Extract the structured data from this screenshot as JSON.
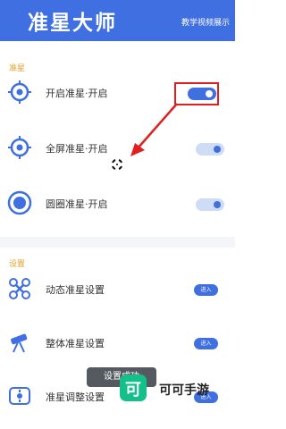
{
  "header": {
    "title": "准星大师",
    "tutorial_link": "教学视频展示"
  },
  "sections": {
    "crosshair": {
      "label": "准星",
      "items": [
        {
          "label": "开启准星·开启",
          "toggle_on": true
        },
        {
          "label": "全屏准星·开启",
          "toggle_on": false
        },
        {
          "label": "圆圈准星·开启",
          "toggle_on": false
        }
      ]
    },
    "settings": {
      "label": "设置",
      "items": [
        {
          "label": "动态准星设置",
          "button": "进入"
        },
        {
          "label": "整体准星设置",
          "button": "进入"
        },
        {
          "label": "准星调整设置",
          "button": "进入"
        }
      ]
    }
  },
  "toast": "设置成功",
  "watermark": {
    "logo_char": "可",
    "text": "可可手游"
  },
  "colors": {
    "primary": "#3f6fe0",
    "section_label": "#e0a12a",
    "annotation": "#e02020"
  }
}
